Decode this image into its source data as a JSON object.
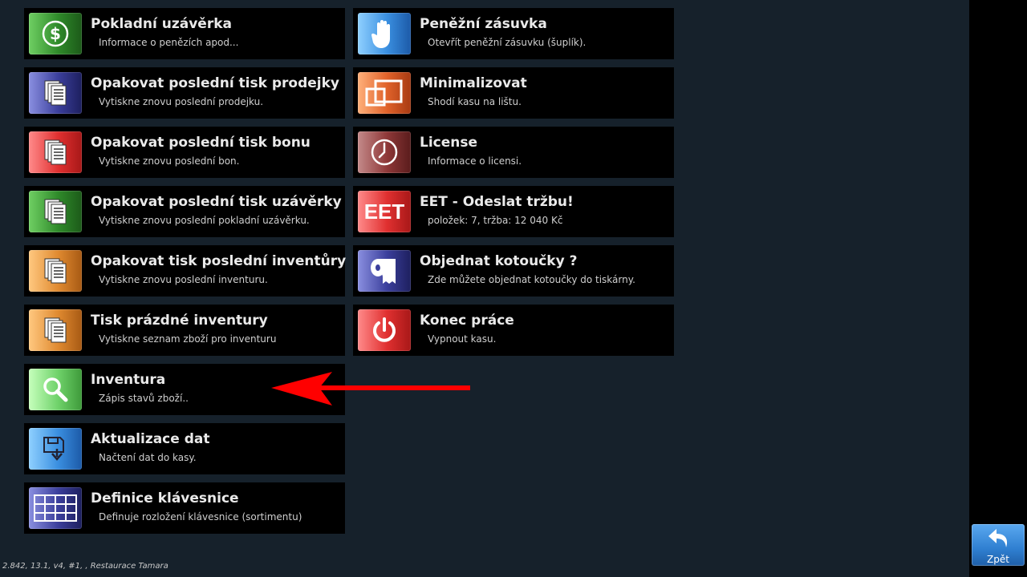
{
  "tiles_left": [
    {
      "title": "Pokladní uzávěrka",
      "subtitle": "Informace o penězích apod...",
      "icon": "dollar-coin-icon",
      "color": "#2f8a2a"
    },
    {
      "title": "Opakovat poslední tisk prodejky",
      "subtitle": "Vytiskne znovu poslední prodejku.",
      "icon": "documents-icon",
      "color": "#3b3f9c"
    },
    {
      "title": "Opakovat poslední tisk bonu",
      "subtitle": "Vytiskne znovu poslední bon.",
      "icon": "documents-icon",
      "color": "#e03030"
    },
    {
      "title": "Opakovat poslední tisk uzávěrky",
      "subtitle": "Vytiskne znovu poslední pokladní uzávěrku.",
      "icon": "documents-icon",
      "color": "#2f8a2a"
    },
    {
      "title": "Opakovat tisk poslední inventůry",
      "subtitle": "Vytiskne znovu poslední inventuru.",
      "icon": "documents-icon",
      "color": "#e08a30"
    },
    {
      "title": "Tisk prázdné inventury",
      "subtitle": "Vytiskne seznam zboží pro inventuru",
      "icon": "documents-icon",
      "color": "#e08a30"
    },
    {
      "title": "Inventura",
      "subtitle": "Zápis stavů zboží..",
      "icon": "magnifier-icon",
      "color": "#6fd26a"
    },
    {
      "title": "Aktualizace dat",
      "subtitle": "Načtení dat do kasy.",
      "icon": "save-download-icon",
      "color": "#3a8fe0"
    },
    {
      "title": "Definice klávesnice",
      "subtitle": "Definuje rozložení klávesnice (sortimentu)",
      "icon": "grid-icon",
      "color": "#3b3f9c"
    }
  ],
  "tiles_right": [
    {
      "title": "Peněžní zásuvka",
      "subtitle": "Otevřít peněžní zásuvku (šuplík).",
      "icon": "hand-icon",
      "color": "#3a8fe0"
    },
    {
      "title": "Minimalizovat",
      "subtitle": "Shodí kasu na lištu.",
      "icon": "minimize-windows-icon",
      "color": "#e0622a"
    },
    {
      "title": "License",
      "subtitle": "Informace o licensi.",
      "icon": "clock-icon",
      "color": "#8e3838"
    },
    {
      "title": "EET - Odeslat tržbu!",
      "subtitle": "položek: 7, tržba: 12 040 Kč",
      "icon": "eet-icon",
      "icon_text": "EET",
      "color": "#e03030"
    },
    {
      "title": "Objednat kotoučky ?",
      "subtitle": "Zde můžete objednat kotoučky do tiskárny.",
      "icon": "paper-roll-icon",
      "color": "#3b3f9c"
    },
    {
      "title": "Konec práce",
      "subtitle": "Vypnout kasu.",
      "icon": "power-icon",
      "color": "#e03030"
    }
  ],
  "back_button": {
    "label": "Zpět",
    "icon": "back-arrow-icon"
  },
  "footer_text": "2.842, 13.1, v4, #1, , Restaurace Tamara",
  "annotation": {
    "icon": "red-arrow-icon",
    "color": "#ff0000"
  }
}
